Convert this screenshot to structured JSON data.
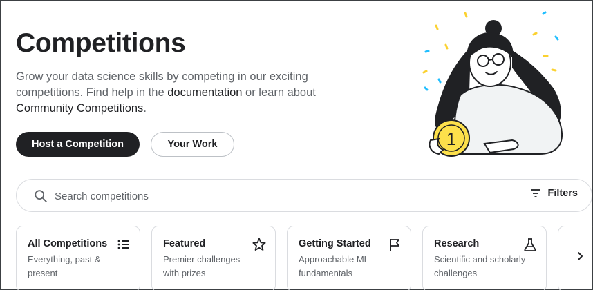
{
  "header": {
    "title": "Competitions",
    "desc_prefix": "Grow your data science skills by competing in our exciting competitions. Find help in the ",
    "doc_link": "documentation",
    "desc_middle": " or learn about ",
    "community_link": "Community Competitions",
    "desc_suffix": "."
  },
  "buttons": {
    "host": "Host a Competition",
    "work": "Your Work"
  },
  "search": {
    "placeholder": "Search competitions",
    "value": "",
    "filters_label": "Filters"
  },
  "categories": [
    {
      "title": "All Competitions",
      "subtitle": "Everything, past & present",
      "icon": "list-icon"
    },
    {
      "title": "Featured",
      "subtitle": "Premier challenges with prizes",
      "icon": "star-icon"
    },
    {
      "title": "Getting Started",
      "subtitle": "Approachable ML fundamentals",
      "icon": "flag-icon"
    },
    {
      "title": "Research",
      "subtitle": "Scientific and scholarly challenges",
      "icon": "flask-icon"
    }
  ],
  "illustration": {
    "coin_label": "1"
  },
  "colors": {
    "primary": "#202124",
    "muted": "#5f6368",
    "border": "#dadce0",
    "coin": "#fde04b",
    "confetti_yellow": "#fbd12f",
    "confetti_blue": "#20beff"
  }
}
